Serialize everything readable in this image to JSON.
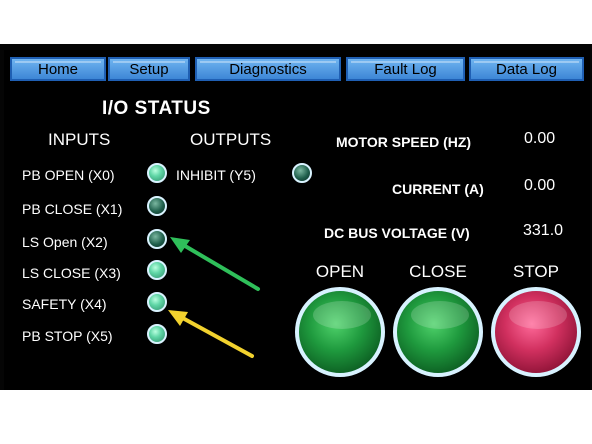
{
  "tabs": [
    "Home",
    "Setup",
    "Diagnostics",
    "Fault Log",
    "Data Log"
  ],
  "title": "I/O STATUS",
  "inputs_header": "INPUTS",
  "outputs_header": "OUTPUTS",
  "inputs": [
    {
      "label": "PB OPEN (X0)",
      "state": "on"
    },
    {
      "label": "PB CLOSE (X1)",
      "state": "off"
    },
    {
      "label": "LS Open (X2)",
      "state": "off"
    },
    {
      "label": "LS CLOSE (X3)",
      "state": "on"
    },
    {
      "label": "SAFETY (X4)",
      "state": "on"
    },
    {
      "label": "PB STOP (X5)",
      "state": "on"
    }
  ],
  "outputs": [
    {
      "label": "INHIBIT (Y5)",
      "state": "off"
    }
  ],
  "readings": [
    {
      "label": "MOTOR SPEED (HZ)",
      "value": "0.00"
    },
    {
      "label": "CURRENT (A)",
      "value": "0.00"
    },
    {
      "label": "DC BUS VOLTAGE (V)",
      "value": "331.0"
    }
  ],
  "buttons": [
    {
      "label": "OPEN",
      "color": "green"
    },
    {
      "label": "CLOSE",
      "color": "green"
    },
    {
      "label": "STOP",
      "color": "red"
    }
  ],
  "colors": {
    "tab_fill": "#3d86d6",
    "arrow_green": "#2fbf5a",
    "arrow_yellow": "#f2d22e"
  }
}
